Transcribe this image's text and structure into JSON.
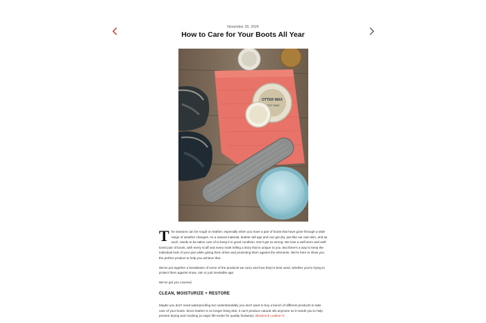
{
  "post": {
    "date": "November 26, 2024",
    "title": "How to Care for Your Boots All Year"
  },
  "nav": {
    "prev_icon": "chevron-left-icon",
    "next_icon": "chevron-right-icon"
  },
  "hero_image": {
    "jar_label": "OTTER WAX",
    "jar_sublabel": "BOOT WAX"
  },
  "article": {
    "dropcap": "T",
    "p1": "he seasons can be rough on leather, especially when you have a pair of boots that have gone through a wide range of weather changes. As a natural material, leather will age and can get dry, just like our own skin, and as such, needs to be taken care of to keep it in good condition. Don't get us wrong: We love a well-worn and well-loved pair of boots, with every scuff and every mark telling a story that is unique to you. But there's a way to keep the individual look of your pair while giving them shine and protecting them against the elements. We're here to show you the perfect product to help you achieve that.",
    "p2": "We've put together a breakdown of some of the products we carry and how they're best used, whether you're trying to protect them against snow, rain or just inevitable age.",
    "p3": "We've got you covered.",
    "subhead": "CLEAN, MOISTURIZE + RESTORE",
    "p4": "Maybe you don't need waterproofing but understandably you don't want to buy a bunch of different products to take care of your boots.  Since leather is no longer living skin, it can't produce natural oils anymore so it needs you to help prevent drying and cracking (a major life-ender for quality footwear).",
    "p4_link": "Blackrock Leather N"
  },
  "colors": {
    "accent": "#c0392b",
    "arrow_right": "#555555"
  }
}
